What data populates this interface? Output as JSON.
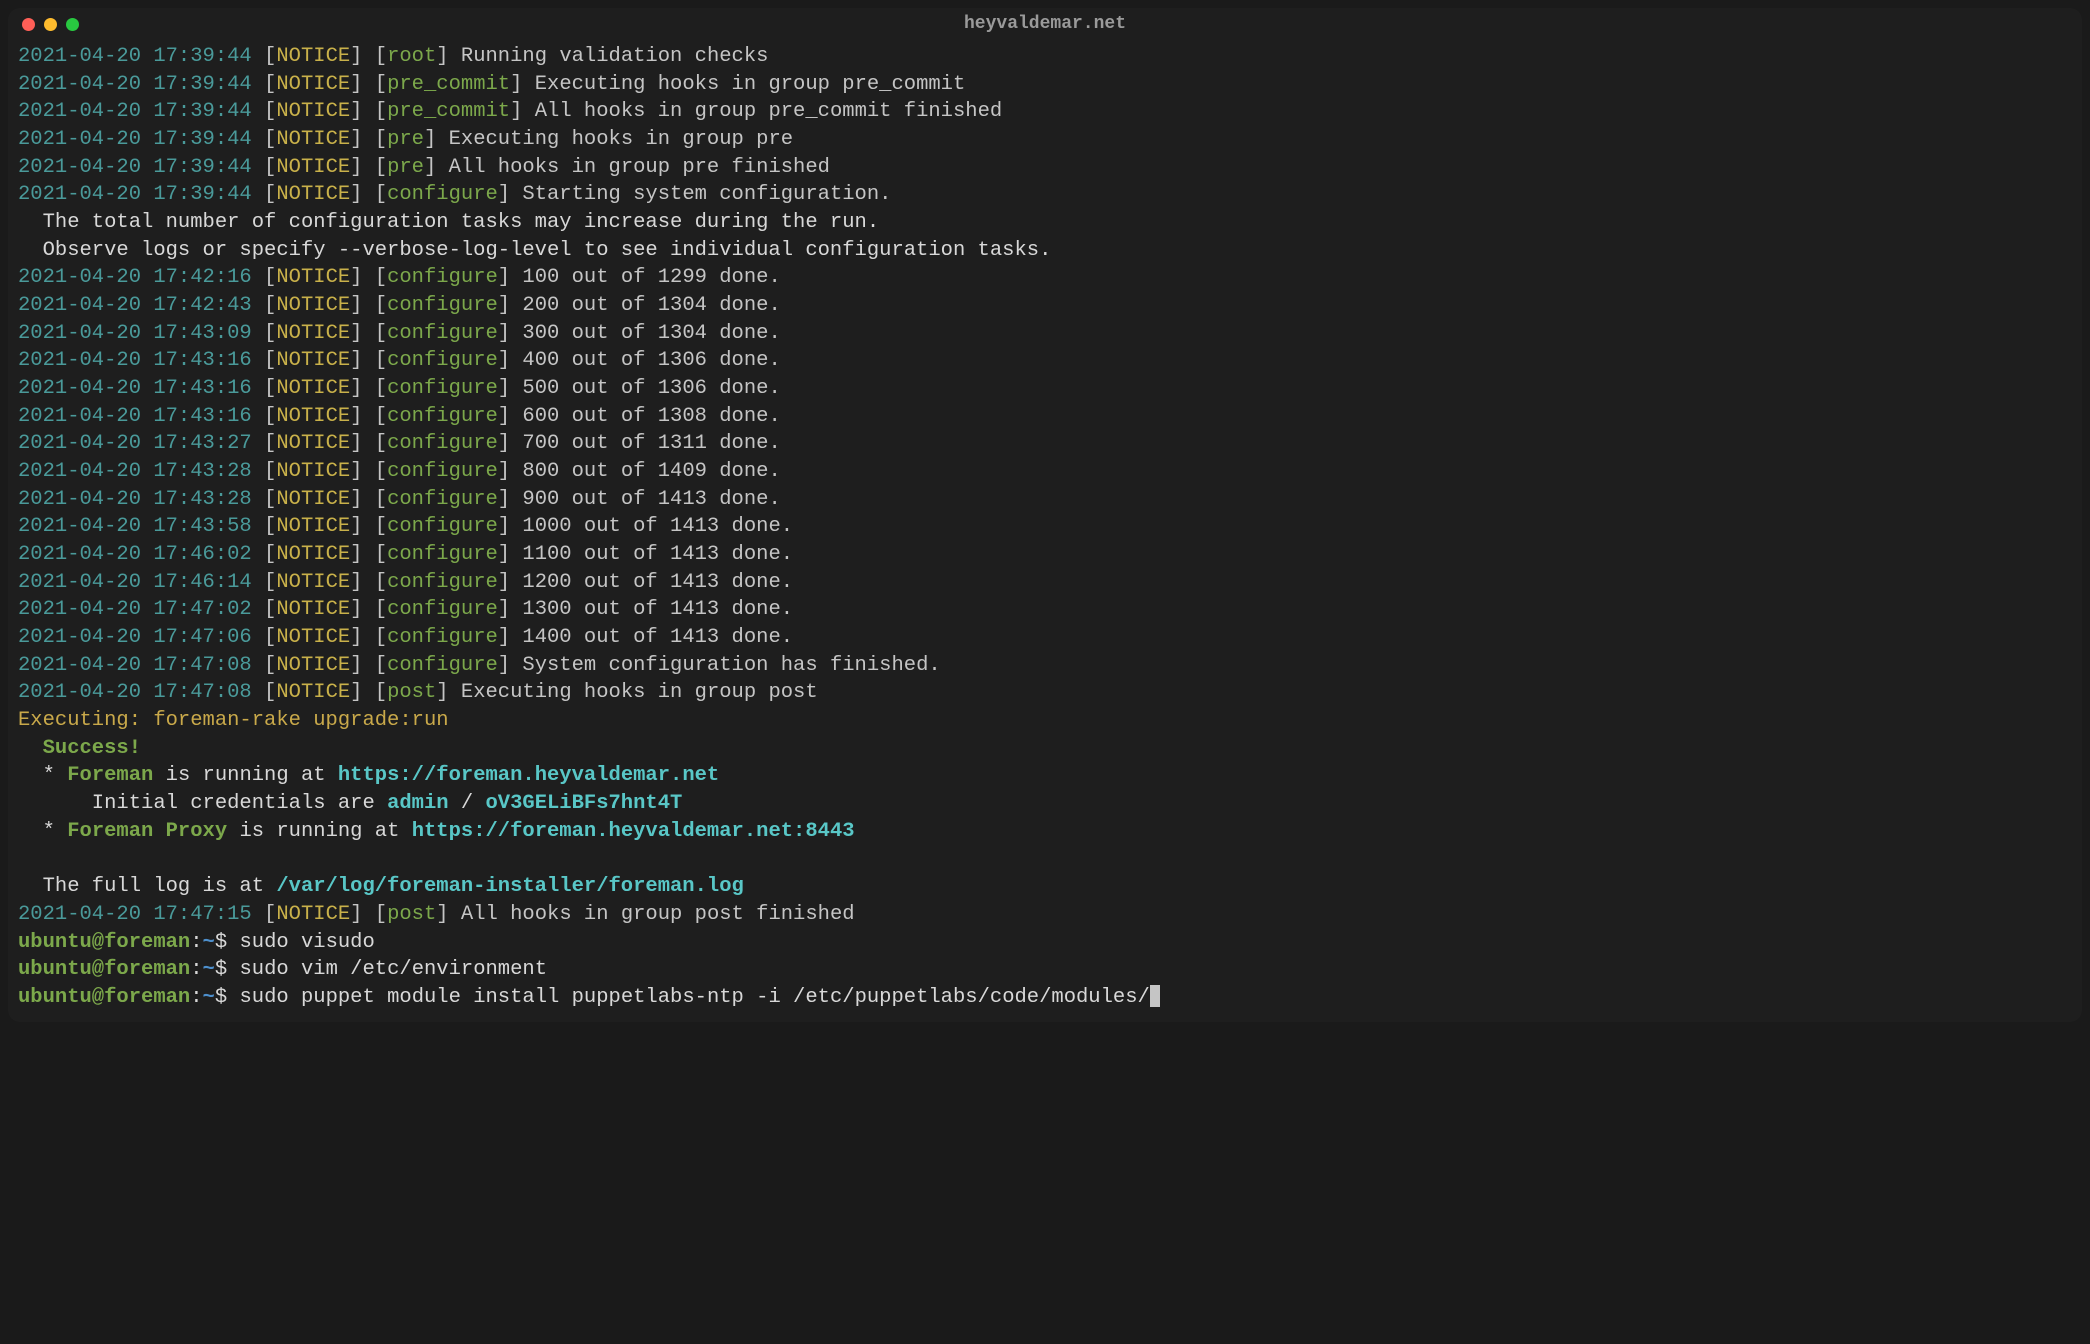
{
  "window": {
    "title": "heyvaldemar.net"
  },
  "log_lines": [
    {
      "ts": "2021-04-20 17:39:44",
      "lvl": "NOTICE",
      "ctx": "root",
      "msg": "Running validation checks"
    },
    {
      "ts": "2021-04-20 17:39:44",
      "lvl": "NOTICE",
      "ctx": "pre_commit",
      "msg": "Executing hooks in group pre_commit"
    },
    {
      "ts": "2021-04-20 17:39:44",
      "lvl": "NOTICE",
      "ctx": "pre_commit",
      "msg": "All hooks in group pre_commit finished"
    },
    {
      "ts": "2021-04-20 17:39:44",
      "lvl": "NOTICE",
      "ctx": "pre",
      "msg": "Executing hooks in group pre"
    },
    {
      "ts": "2021-04-20 17:39:44",
      "lvl": "NOTICE",
      "ctx": "pre",
      "msg": "All hooks in group pre finished"
    },
    {
      "ts": "2021-04-20 17:39:44",
      "lvl": "NOTICE",
      "ctx": "configure",
      "msg": "Starting system configuration."
    }
  ],
  "info_lines": [
    "  The total number of configuration tasks may increase during the run.",
    "  Observe logs or specify --verbose-log-level to see individual configuration tasks."
  ],
  "progress_lines": [
    {
      "ts": "2021-04-20 17:42:16",
      "lvl": "NOTICE",
      "ctx": "configure",
      "msg": "100 out of 1299 done."
    },
    {
      "ts": "2021-04-20 17:42:43",
      "lvl": "NOTICE",
      "ctx": "configure",
      "msg": "200 out of 1304 done."
    },
    {
      "ts": "2021-04-20 17:43:09",
      "lvl": "NOTICE",
      "ctx": "configure",
      "msg": "300 out of 1304 done."
    },
    {
      "ts": "2021-04-20 17:43:16",
      "lvl": "NOTICE",
      "ctx": "configure",
      "msg": "400 out of 1306 done."
    },
    {
      "ts": "2021-04-20 17:43:16",
      "lvl": "NOTICE",
      "ctx": "configure",
      "msg": "500 out of 1306 done."
    },
    {
      "ts": "2021-04-20 17:43:16",
      "lvl": "NOTICE",
      "ctx": "configure",
      "msg": "600 out of 1308 done."
    },
    {
      "ts": "2021-04-20 17:43:27",
      "lvl": "NOTICE",
      "ctx": "configure",
      "msg": "700 out of 1311 done."
    },
    {
      "ts": "2021-04-20 17:43:28",
      "lvl": "NOTICE",
      "ctx": "configure",
      "msg": "800 out of 1409 done."
    },
    {
      "ts": "2021-04-20 17:43:28",
      "lvl": "NOTICE",
      "ctx": "configure",
      "msg": "900 out of 1413 done."
    },
    {
      "ts": "2021-04-20 17:43:58",
      "lvl": "NOTICE",
      "ctx": "configure",
      "msg": "1000 out of 1413 done."
    },
    {
      "ts": "2021-04-20 17:46:02",
      "lvl": "NOTICE",
      "ctx": "configure",
      "msg": "1100 out of 1413 done."
    },
    {
      "ts": "2021-04-20 17:46:14",
      "lvl": "NOTICE",
      "ctx": "configure",
      "msg": "1200 out of 1413 done."
    },
    {
      "ts": "2021-04-20 17:47:02",
      "lvl": "NOTICE",
      "ctx": "configure",
      "msg": "1300 out of 1413 done."
    },
    {
      "ts": "2021-04-20 17:47:06",
      "lvl": "NOTICE",
      "ctx": "configure",
      "msg": "1400 out of 1413 done."
    },
    {
      "ts": "2021-04-20 17:47:08",
      "lvl": "NOTICE",
      "ctx": "configure",
      "msg": "System configuration has finished."
    },
    {
      "ts": "2021-04-20 17:47:08",
      "lvl": "NOTICE",
      "ctx": "post",
      "msg": "Executing hooks in group post"
    }
  ],
  "executing_line": "Executing: foreman-rake upgrade:run",
  "success_label": "  Success!",
  "foreman_line": {
    "prefix": "  * ",
    "name": "Foreman",
    "mid": " is running at ",
    "url": "https://foreman.heyvaldemar.net"
  },
  "creds_line": {
    "prefix": "      Initial credentials are ",
    "user": "admin",
    "sep": " / ",
    "pass": "oV3GELiBFs7hnt4T"
  },
  "proxy_line": {
    "prefix": "  * ",
    "name": "Foreman Proxy",
    "mid": " is running at ",
    "url": "https://foreman.heyvaldemar.net:8443"
  },
  "log_path_line": {
    "prefix": "  The full log is at ",
    "path": "/var/log/foreman-installer/foreman.log"
  },
  "post_finished": {
    "ts": "2021-04-20 17:47:15",
    "lvl": "NOTICE",
    "ctx": "post",
    "msg": "All hooks in group post finished"
  },
  "prompts": [
    {
      "user_host": "ubuntu@foreman",
      "colon": ":",
      "path": "~",
      "dollar": "$ ",
      "cmd": "sudo visudo"
    },
    {
      "user_host": "ubuntu@foreman",
      "colon": ":",
      "path": "~",
      "dollar": "$ ",
      "cmd": "sudo vim /etc/environment"
    },
    {
      "user_host": "ubuntu@foreman",
      "colon": ":",
      "path": "~",
      "dollar": "$ ",
      "cmd": "sudo puppet module install puppetlabs-ntp -i /etc/puppetlabs/code/modules/"
    }
  ]
}
